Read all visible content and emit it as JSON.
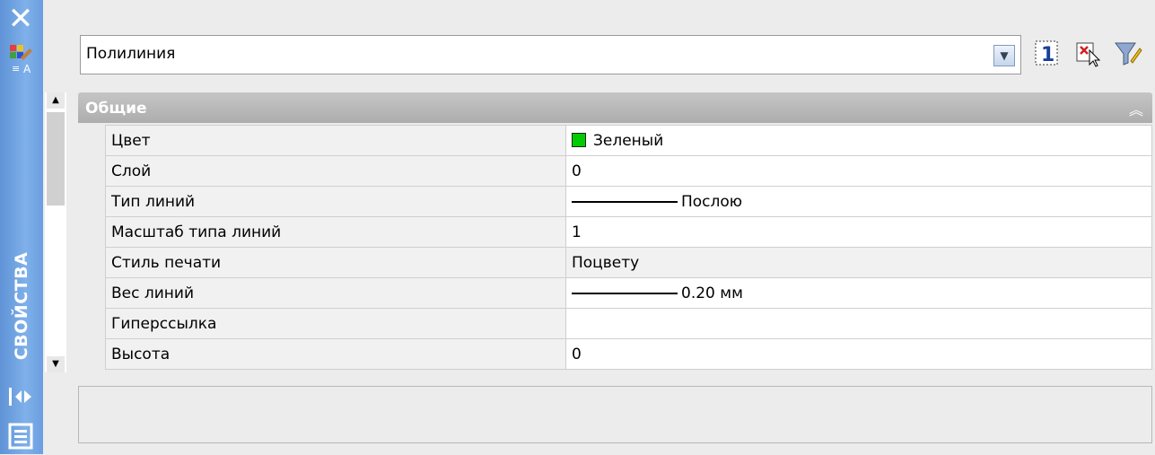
{
  "palette": {
    "title": "СВОЙСТВА",
    "close_icon": "close-icon",
    "settings_icon": "properties-settings-icon",
    "autohide_icon": "autohide-icon",
    "menu_icon": "properties-menu-icon"
  },
  "selector": {
    "value": "Полилиния",
    "dropdown_icon": "chevron-down-icon"
  },
  "toolbar": {
    "buttons": [
      {
        "name": "toggle-pickadd-button",
        "icon": "pickadd-icon",
        "label": "1"
      },
      {
        "name": "select-objects-button",
        "icon": "select-objects-icon"
      },
      {
        "name": "quick-select-button",
        "icon": "quick-select-icon"
      }
    ]
  },
  "section": {
    "title": "Общие",
    "collapse_icon": "double-chevron-up-icon"
  },
  "properties": [
    {
      "name": "Цвет",
      "value": "Зеленый",
      "swatch": "#00cc00"
    },
    {
      "name": "Слой",
      "value": "0"
    },
    {
      "name": "Тип линий",
      "value": "Послою",
      "line_sample": true
    },
    {
      "name": "Масштаб типа линий",
      "value": "1"
    },
    {
      "name": "Стиль печати",
      "value": "Поцвету",
      "readonly": true
    },
    {
      "name": "Вес линий",
      "value": "0.20 мм",
      "line_sample": true
    },
    {
      "name": "Гиперссылка",
      "value": ""
    },
    {
      "name": "Высота",
      "value": "0"
    }
  ]
}
